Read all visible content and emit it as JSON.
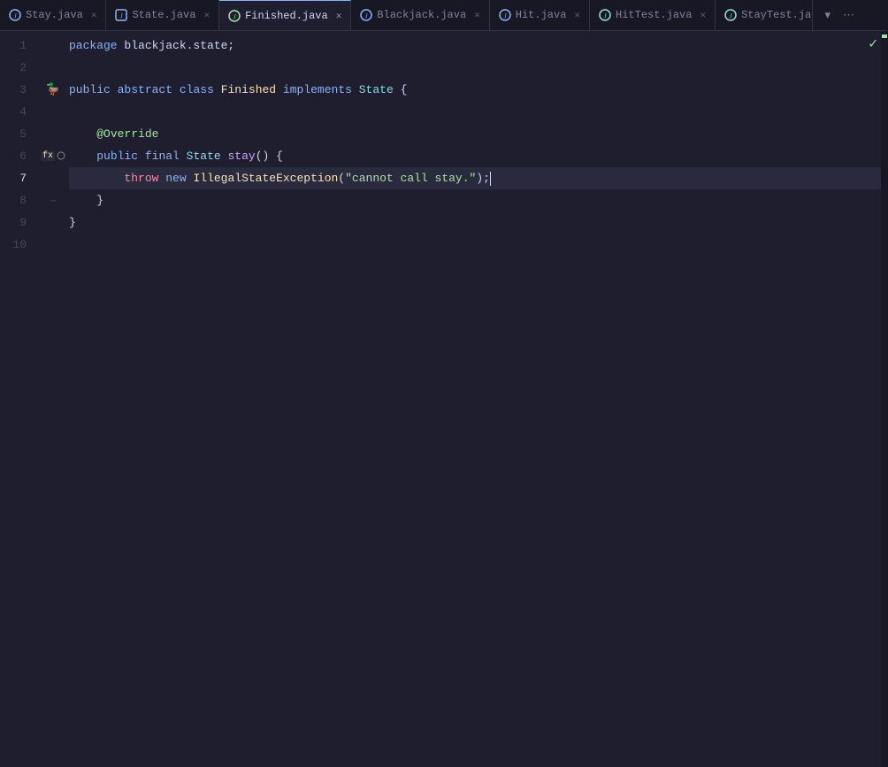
{
  "tabs": [
    {
      "id": "stay",
      "label": "Stay.java",
      "icon": "java-blue",
      "active": false,
      "modified": false,
      "closeable": true
    },
    {
      "id": "state",
      "label": "State.java",
      "icon": "java-blue",
      "active": false,
      "modified": false,
      "closeable": true
    },
    {
      "id": "finished",
      "label": "Finished.java",
      "icon": "java-green",
      "active": true,
      "modified": false,
      "closeable": true
    },
    {
      "id": "blackjack",
      "label": "Blackjack.java",
      "icon": "java-blue",
      "active": false,
      "modified": false,
      "closeable": true
    },
    {
      "id": "hit",
      "label": "Hit.java",
      "icon": "java-blue",
      "active": false,
      "modified": false,
      "closeable": true
    },
    {
      "id": "hittest",
      "label": "HitTest.java",
      "icon": "java-teal",
      "active": false,
      "modified": false,
      "closeable": true
    },
    {
      "id": "staytest",
      "label": "StayTest.java",
      "icon": "java-teal",
      "active": false,
      "modified": false,
      "closeable": true
    }
  ],
  "tab_actions": {
    "chevron_down": "▾",
    "more": "⋯"
  },
  "code": {
    "lines": [
      {
        "num": 1,
        "content": "package blackjack.state;",
        "parts": [
          {
            "text": "package",
            "cls": "kw-blue"
          },
          {
            "text": " blackjack.state;",
            "cls": "kw-white"
          }
        ]
      },
      {
        "num": 2,
        "content": "",
        "parts": []
      },
      {
        "num": 3,
        "content": "public abstract class Finished implements State {",
        "parts": [
          {
            "text": "public",
            "cls": "kw-blue"
          },
          {
            "text": " abstract",
            "cls": "kw-blue"
          },
          {
            "text": " class",
            "cls": "kw-blue"
          },
          {
            "text": " Finished",
            "cls": "kw-class-name"
          },
          {
            "text": " implements",
            "cls": "kw-blue"
          },
          {
            "text": " State",
            "cls": "kw-type"
          },
          {
            "text": " {",
            "cls": "kw-white"
          }
        ]
      },
      {
        "num": 4,
        "content": "",
        "parts": []
      },
      {
        "num": 5,
        "content": "    @Override",
        "parts": [
          {
            "text": "    @Override",
            "cls": "kw-annotation"
          }
        ]
      },
      {
        "num": 6,
        "content": "    public final State stay() {",
        "parts": [
          {
            "text": "    public",
            "cls": "kw-blue"
          },
          {
            "text": " final",
            "cls": "kw-blue"
          },
          {
            "text": " State",
            "cls": "kw-type"
          },
          {
            "text": " stay",
            "cls": "kw-mauve"
          },
          {
            "text": "() {",
            "cls": "kw-white"
          }
        ]
      },
      {
        "num": 7,
        "content": "        throw new IllegalStateException(\"cannot call stay.\");",
        "parts": [
          {
            "text": "        throw",
            "cls": "kw-red"
          },
          {
            "text": " new",
            "cls": "kw-blue"
          },
          {
            "text": " IllegalStateException",
            "cls": "kw-class-name"
          },
          {
            "text": "(",
            "cls": "kw-white"
          },
          {
            "text": "\"cannot call stay.\"",
            "cls": "kw-string"
          },
          {
            "text": ");",
            "cls": "kw-white"
          }
        ]
      },
      {
        "num": 8,
        "content": "    }",
        "parts": [
          {
            "text": "    }",
            "cls": "kw-white"
          }
        ]
      },
      {
        "num": 9,
        "content": "}",
        "parts": [
          {
            "text": "}",
            "cls": "kw-white"
          }
        ]
      },
      {
        "num": 10,
        "content": "",
        "parts": []
      }
    ]
  },
  "checkmark_char": "✓",
  "cursor_line": 7
}
